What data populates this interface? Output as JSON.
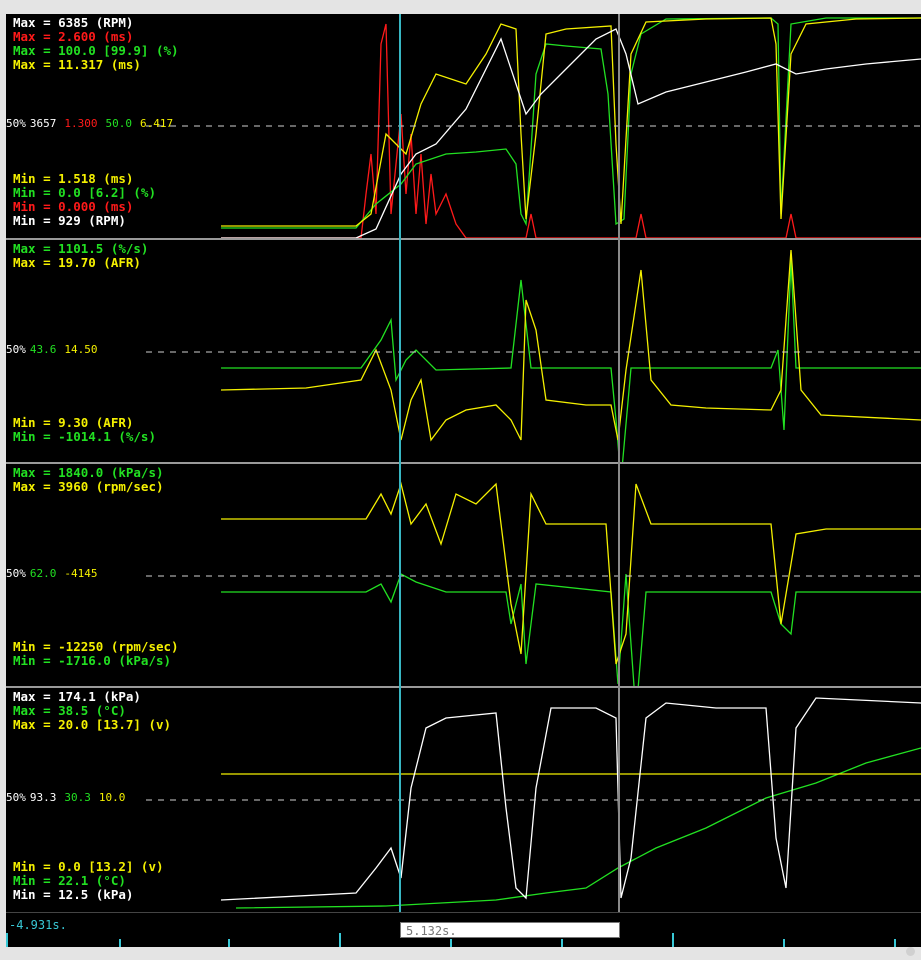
{
  "colors": {
    "white": "#ffffff",
    "red": "#ff1a1a",
    "green": "#22e022",
    "yellow": "#f4f000",
    "cursor": "#38b6c2"
  },
  "panels": [
    {
      "max": [
        {
          "text": "Max = 6385 (RPM)",
          "color": "#ffffff"
        },
        {
          "text": "Max = 2.600 (ms)",
          "color": "#ff1a1a"
        },
        {
          "text": "Max = 100.0 [99.9] (%)",
          "color": "#22e022"
        },
        {
          "text": "Max = 11.317 (ms)",
          "color": "#f4f000"
        }
      ],
      "mid": [
        {
          "text": "3657",
          "color": "#ffffff"
        },
        {
          "text": "1.300",
          "color": "#ff1a1a"
        },
        {
          "text": "50.0",
          "color": "#22e022"
        },
        {
          "text": "6.417",
          "color": "#f4f000"
        }
      ],
      "min": [
        {
          "text": "Min = 1.518 (ms)",
          "color": "#f4f000"
        },
        {
          "text": "Min = 0.0 [6.2] (%)",
          "color": "#22e022"
        },
        {
          "text": "Min = 0.000 (ms)",
          "color": "#ff1a1a"
        },
        {
          "text": "Min = 929 (RPM)",
          "color": "#ffffff"
        }
      ]
    },
    {
      "max": [
        {
          "text": "Max = 1101.5 (%/s)",
          "color": "#22e022"
        },
        {
          "text": "Max = 19.70 (AFR)",
          "color": "#f4f000"
        }
      ],
      "mid": [
        {
          "text": "43.6",
          "color": "#22e022"
        },
        {
          "text": "14.50",
          "color": "#f4f000"
        }
      ],
      "min": [
        {
          "text": "Min = 9.30 (AFR)",
          "color": "#f4f000"
        },
        {
          "text": "Min = -1014.1 (%/s)",
          "color": "#22e022"
        }
      ]
    },
    {
      "max": [
        {
          "text": "Max = 1840.0 (kPa/s)",
          "color": "#22e022"
        },
        {
          "text": "Max = 3960 (rpm/sec)",
          "color": "#f4f000"
        }
      ],
      "mid": [
        {
          "text": "62.0",
          "color": "#22e022"
        },
        {
          "text": "-4145",
          "color": "#f4f000"
        }
      ],
      "min": [
        {
          "text": "Min = -12250 (rpm/sec)",
          "color": "#f4f000"
        },
        {
          "text": "Min = -1716.0 (kPa/s)",
          "color": "#22e022"
        }
      ]
    },
    {
      "max": [
        {
          "text": "Max = 174.1 (kPa)",
          "color": "#ffffff"
        },
        {
          "text": "Max = 38.5 (°C)",
          "color": "#22e022"
        },
        {
          "text": "Max = 20.0 [13.7] (v)",
          "color": "#f4f000"
        }
      ],
      "mid": [
        {
          "text": "93.3",
          "color": "#ffffff"
        },
        {
          "text": "30.3",
          "color": "#22e022"
        },
        {
          "text": "10.0",
          "color": "#f4f000"
        }
      ],
      "min": [
        {
          "text": "Min = 0.0 [13.2] (v)",
          "color": "#f4f000"
        },
        {
          "text": "Min = 22.1 (°C)",
          "color": "#22e022"
        },
        {
          "text": "Min = 12.5 (kPa)",
          "color": "#ffffff"
        }
      ]
    }
  ],
  "label_50": "50%",
  "timebar": {
    "left_time": "-4.931s.",
    "cursor_time": "5.132s."
  }
}
